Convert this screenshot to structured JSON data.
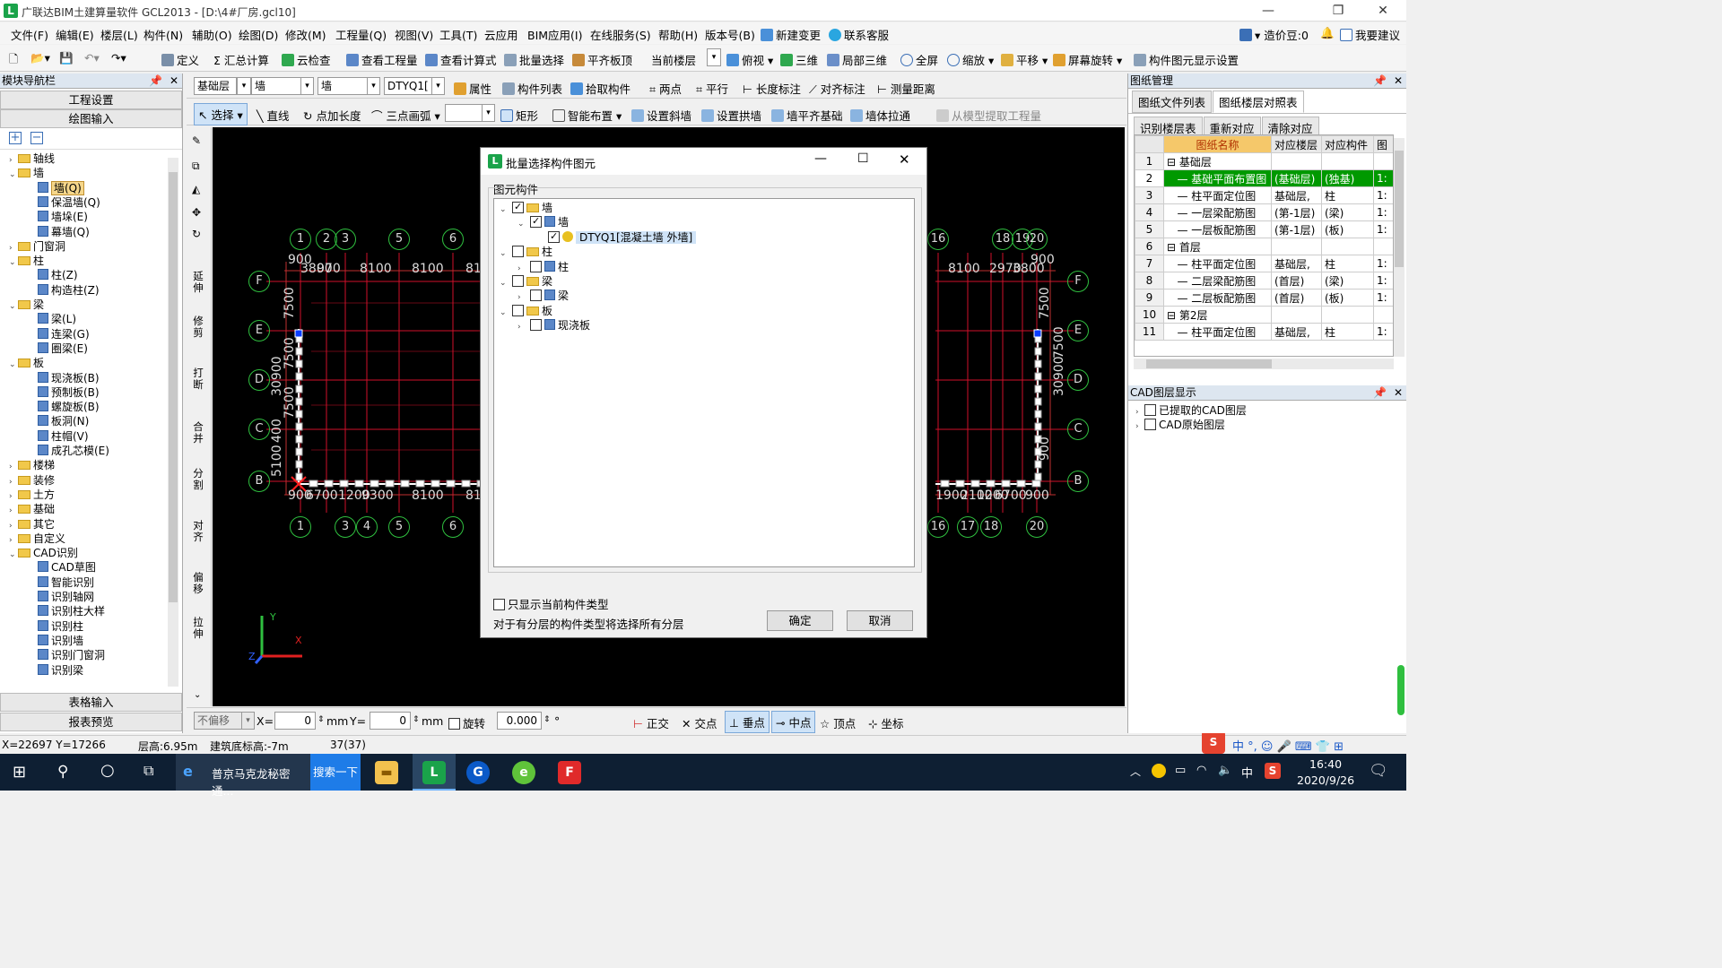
{
  "window": {
    "title": "广联达BIM土建算量软件 GCL2013 - [D:\\4#厂房.gcl10]"
  },
  "menu": [
    "文件(F)",
    "编辑(E)",
    "楼层(L)",
    "构件(N)",
    "辅助(O)",
    "绘图(D)",
    "修改(M)",
    "工程量(Q)",
    "视图(V)",
    "工具(T)",
    "云应用",
    "BIM应用(I)",
    "在线服务(S)",
    "帮助(H)",
    "版本号(B)",
    "新建变更",
    "联系客服"
  ],
  "menu_right": {
    "price": "造价豆:0",
    "suggest": "我要建议"
  },
  "toolbar1": [
    "定义",
    "汇总计算",
    "云检查",
    "查看工程量",
    "查看计算式",
    "批量选择",
    "平齐板顶",
    "当前楼层",
    "俯视",
    "三维",
    "局部三维",
    "全屏",
    "缩放",
    "平移",
    "屏幕旋转",
    "构件图元显示设置"
  ],
  "toolbar2": {
    "floor": "基础层",
    "category": "墙",
    "type": "墙",
    "element": "DTYQ1[",
    "buttons": [
      "属性",
      "构件列表",
      "拾取构件",
      "两点",
      "平行",
      "长度标注",
      "对齐标注",
      "测量距离"
    ]
  },
  "toolbar3": {
    "buttons": [
      "选择",
      "直线",
      "点加长度",
      "三点画弧",
      "矩形",
      "智能布置",
      "设置斜墙",
      "设置拱墙",
      "墙平齐基础",
      "墙体拉通",
      "从模型提取工程量"
    ]
  },
  "vtoolbar": [
    "延伸",
    "修剪",
    "打断",
    "合并",
    "分割",
    "对齐",
    "偏移",
    "拉伸"
  ],
  "leftnav": {
    "header": "模块导航栏",
    "btn_project": "工程设置",
    "btn_draw": "绘图输入",
    "tree": [
      {
        "label": "轴线",
        "level": 0,
        "kind": "folder",
        "exp": "›"
      },
      {
        "label": "墙",
        "level": 0,
        "kind": "folder",
        "exp": "⌄"
      },
      {
        "label": "墙(Q)",
        "level": 1,
        "kind": "leaf",
        "selected": true
      },
      {
        "label": "保温墙(Q)",
        "level": 1,
        "kind": "leaf"
      },
      {
        "label": "墙垛(E)",
        "level": 1,
        "kind": "leaf"
      },
      {
        "label": "幕墙(Q)",
        "level": 1,
        "kind": "leaf"
      },
      {
        "label": "门窗洞",
        "level": 0,
        "kind": "folder",
        "exp": "›"
      },
      {
        "label": "柱",
        "level": 0,
        "kind": "folder",
        "exp": "⌄"
      },
      {
        "label": "柱(Z)",
        "level": 1,
        "kind": "leaf"
      },
      {
        "label": "构造柱(Z)",
        "level": 1,
        "kind": "leaf"
      },
      {
        "label": "梁",
        "level": 0,
        "kind": "folder",
        "exp": "⌄"
      },
      {
        "label": "梁(L)",
        "level": 1,
        "kind": "leaf"
      },
      {
        "label": "连梁(G)",
        "level": 1,
        "kind": "leaf"
      },
      {
        "label": "圈梁(E)",
        "level": 1,
        "kind": "leaf"
      },
      {
        "label": "板",
        "level": 0,
        "kind": "folder",
        "exp": "⌄"
      },
      {
        "label": "现浇板(B)",
        "level": 1,
        "kind": "leaf"
      },
      {
        "label": "预制板(B)",
        "level": 1,
        "kind": "leaf"
      },
      {
        "label": "螺旋板(B)",
        "level": 1,
        "kind": "leaf"
      },
      {
        "label": "板洞(N)",
        "level": 1,
        "kind": "leaf"
      },
      {
        "label": "柱帽(V)",
        "level": 1,
        "kind": "leaf"
      },
      {
        "label": "成孔芯模(E)",
        "level": 1,
        "kind": "leaf"
      },
      {
        "label": "楼梯",
        "level": 0,
        "kind": "folder",
        "exp": "›"
      },
      {
        "label": "装修",
        "level": 0,
        "kind": "folder",
        "exp": "›"
      },
      {
        "label": "土方",
        "level": 0,
        "kind": "folder",
        "exp": "›"
      },
      {
        "label": "基础",
        "level": 0,
        "kind": "folder",
        "exp": "›"
      },
      {
        "label": "其它",
        "level": 0,
        "kind": "folder",
        "exp": "›"
      },
      {
        "label": "自定义",
        "level": 0,
        "kind": "folder",
        "exp": "›"
      },
      {
        "label": "CAD识别",
        "level": 0,
        "kind": "folder",
        "exp": "⌄"
      },
      {
        "label": "CAD草图",
        "level": 1,
        "kind": "leaf"
      },
      {
        "label": "智能识别",
        "level": 1,
        "kind": "leaf"
      },
      {
        "label": "识别轴网",
        "level": 1,
        "kind": "leaf"
      },
      {
        "label": "识别柱大样",
        "level": 1,
        "kind": "leaf"
      },
      {
        "label": "识别柱",
        "level": 1,
        "kind": "leaf"
      },
      {
        "label": "识别墙",
        "level": 1,
        "kind": "leaf"
      },
      {
        "label": "识别门窗洞",
        "level": 1,
        "kind": "leaf"
      },
      {
        "label": "识别梁",
        "level": 1,
        "kind": "leaf"
      }
    ],
    "btn_table": "表格输入",
    "btn_report": "报表预览"
  },
  "rightpanel": {
    "header": "图纸管理",
    "tabs": [
      "图纸文件列表",
      "图纸楼层对照表"
    ],
    "actions": [
      "识别楼层表",
      "重新对应",
      "清除对应"
    ],
    "columns": [
      "图纸名称",
      "对应楼层",
      "对应构件",
      "图"
    ],
    "rows": [
      {
        "n": "1",
        "name": "基础层",
        "floor": "",
        "comp": "",
        "x": "",
        "group": true
      },
      {
        "n": "2",
        "name": "基础平面布置图",
        "floor": "(基础层)",
        "comp": "(独基)",
        "x": "1:",
        "selected": true
      },
      {
        "n": "3",
        "name": "柱平面定位图",
        "floor": "基础层,",
        "comp": "柱",
        "x": "1:"
      },
      {
        "n": "4",
        "name": "一层梁配筋图",
        "floor": "(第-1层)",
        "comp": "(梁)",
        "x": "1:"
      },
      {
        "n": "5",
        "name": "一层板配筋图",
        "floor": "(第-1层)",
        "comp": "(板)",
        "x": "1:"
      },
      {
        "n": "6",
        "name": "首层",
        "floor": "",
        "comp": "",
        "x": "",
        "group": true
      },
      {
        "n": "7",
        "name": "柱平面定位图",
        "floor": "基础层,",
        "comp": "柱",
        "x": "1:"
      },
      {
        "n": "8",
        "name": "二层梁配筋图",
        "floor": "(首层)",
        "comp": "(梁)",
        "x": "1:"
      },
      {
        "n": "9",
        "name": "二层板配筋图",
        "floor": "(首层)",
        "comp": "(板)",
        "x": "1:"
      },
      {
        "n": "10",
        "name": "第2层",
        "floor": "",
        "comp": "",
        "x": "",
        "group": true
      },
      {
        "n": "11",
        "name": "柱平面定位图",
        "floor": "基础层,",
        "comp": "柱",
        "x": "1:"
      }
    ],
    "cad_header": "CAD图层显示",
    "cad_layers": [
      "已提取的CAD图层",
      "CAD原始图层"
    ]
  },
  "dialog": {
    "title": "批量选择构件图元",
    "group_label": "图元构件",
    "tree": [
      {
        "label": "墙",
        "level": 0,
        "checked": true,
        "exp": "⌄"
      },
      {
        "label": "墙",
        "level": 1,
        "checked": true,
        "exp": "⌄"
      },
      {
        "label": "DTYQ1[混凝土墙 外墙]",
        "level": 2,
        "checked": true,
        "exp": "",
        "highlight": true
      },
      {
        "label": "柱",
        "level": 0,
        "checked": false,
        "exp": "⌄"
      },
      {
        "label": "柱",
        "level": 1,
        "checked": false,
        "exp": "›"
      },
      {
        "label": "梁",
        "level": 0,
        "checked": false,
        "exp": "⌄"
      },
      {
        "label": "梁",
        "level": 1,
        "checked": false,
        "exp": "›"
      },
      {
        "label": "板",
        "level": 0,
        "checked": false,
        "exp": "⌄"
      },
      {
        "label": "现浇板",
        "level": 1,
        "checked": false,
        "exp": "›"
      }
    ],
    "only_current": "只显示当前构件类型",
    "note": "对于有分层的构件类型将选择所有分层",
    "ok": "确定",
    "cancel": "取消"
  },
  "bottombar": {
    "offset": "不偏移",
    "x_label": "X=",
    "x_val": "0",
    "y_label": "Y=",
    "y_val": "0",
    "unit": "mm",
    "rotate": "旋转",
    "rotate_val": "0.000",
    "deg": "°",
    "snaps": [
      "正交",
      "交点",
      "垂点",
      "中点",
      "顶点",
      "坐标"
    ]
  },
  "status": {
    "coords": "X=22697 Y=17266",
    "floor_height": "层高:6.95m",
    "base_height": "建筑底标高:-7m",
    "count": "37(37)"
  },
  "canvas": {
    "top_axes_left": [
      "1",
      "2",
      "3",
      "5",
      "6"
    ],
    "top_axes_right": [
      "16",
      "18",
      "19",
      "20"
    ],
    "bottom_axes_left": [
      "1",
      "3",
      "4",
      "5",
      "6"
    ],
    "bottom_axes_right": [
      "16",
      "17",
      "18",
      "20"
    ],
    "row_axes": [
      "F",
      "E",
      "D",
      "C",
      "B"
    ],
    "dims_top": [
      "900",
      "3800",
      "970",
      "8100",
      "8100",
      "81"
    ],
    "dims_top_right": [
      "8100",
      "2970",
      "3800",
      "900"
    ],
    "dims_left": [
      "7500",
      "7500",
      "7500",
      "30900",
      "5100",
      "400"
    ],
    "dims_bottom": [
      "900",
      "6700",
      "1200",
      "9300",
      "8100",
      "81"
    ],
    "dims_bottom_right": [
      "1900",
      "2100",
      "1200",
      "6700",
      "900"
    ],
    "dims_right": [
      "7500",
      "30900",
      "7500",
      "900"
    ],
    "axis_labels": {
      "x": "X",
      "y": "Y",
      "z": "Z"
    }
  },
  "taskbar": {
    "search_text": "普京马克龙秘密通...",
    "search_btn": "搜索一下",
    "time": "16:40",
    "date": "2020/9/26",
    "ime": "中"
  },
  "colors": {
    "accent": "#1aa34a",
    "selected_row": "#009900",
    "canvas_bg": "#000000",
    "grid_red": "#d0102a",
    "bubble_green": "#2fbf3f"
  }
}
